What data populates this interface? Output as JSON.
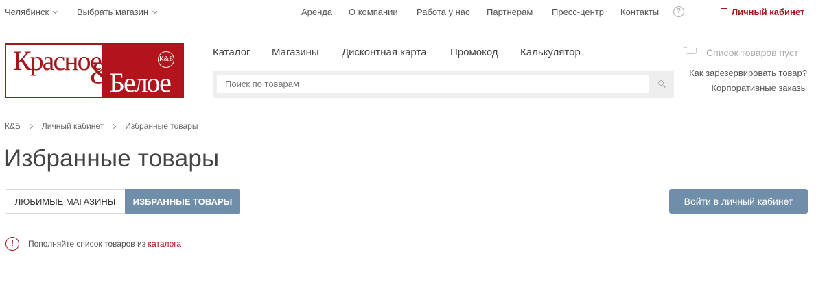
{
  "topbar": {
    "city": "Челябинск",
    "store": "Выбрать магазин",
    "nav": [
      "Аренда",
      "О компании",
      "Работа у нас",
      "Партнерам",
      "Пресс-центр",
      "Контакты"
    ],
    "help_icon": "?",
    "account": "Личный кабинет"
  },
  "logo": {
    "word1": "Красное",
    "amp": "&",
    "word2": "Белое",
    "badge": "К&Б"
  },
  "mainnav": [
    "Каталог",
    "Магазины",
    "Дисконтная карта",
    "Промокод",
    "Калькулятор"
  ],
  "search": {
    "placeholder": "Поиск по товарам",
    "value": ""
  },
  "cart": {
    "text": "Список товаров пуст"
  },
  "side_links": {
    "reserve": "Как зарезервировать товар?",
    "corporate": "Корпоративные заказы"
  },
  "breadcrumb": [
    "К&Б",
    "Личный кабинет",
    "Избранные товары"
  ],
  "page_title": "Избранные товары",
  "tabs": {
    "stores": "Любимые магазины",
    "products": "Избранные товары"
  },
  "login_button": "Войти в личный кабинет",
  "notice": {
    "icon": "!",
    "text": "Пополняйте список товаров из ",
    "link": "каталога"
  },
  "colors": {
    "brand_red": "#a4161a",
    "accent_blue": "#6f8ea9"
  }
}
